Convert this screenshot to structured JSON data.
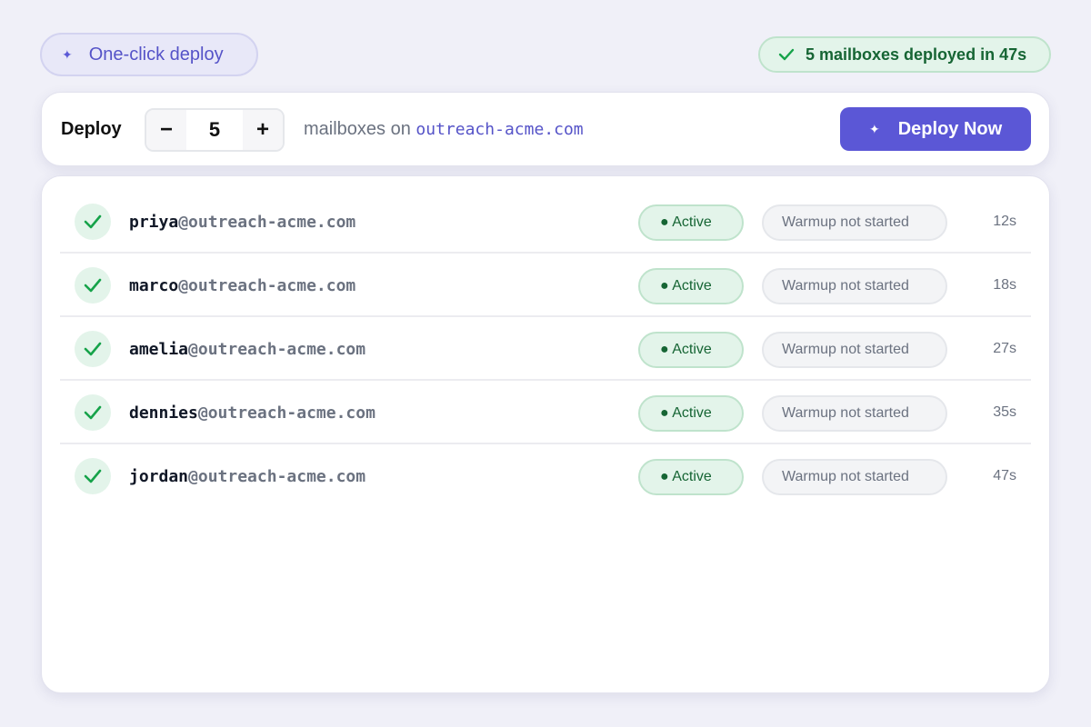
{
  "header": {
    "oneclick_label": "One-click deploy",
    "status_label": "5 mailboxes deployed in 47s"
  },
  "deploy": {
    "label": "Deploy",
    "decrement": "−",
    "count": "5",
    "increment": "+",
    "mailboxes_text": "mailboxes on ",
    "domain": "outreach-acme.com",
    "button_label": "Deploy Now"
  },
  "mailboxes": [
    {
      "user": "priya",
      "domain": "@outreach-acme.com",
      "status": "● Active",
      "warmup": "Warmup not started",
      "time": "12s"
    },
    {
      "user": "marco",
      "domain": "@outreach-acme.com",
      "status": "● Active",
      "warmup": "Warmup not started",
      "time": "18s"
    },
    {
      "user": "amelia",
      "domain": "@outreach-acme.com",
      "status": "● Active",
      "warmup": "Warmup not started",
      "time": "27s"
    },
    {
      "user": "dennies",
      "domain": "@outreach-acme.com",
      "status": "● Active",
      "warmup": "Warmup not started",
      "time": "35s"
    },
    {
      "user": "jordan",
      "domain": "@outreach-acme.com",
      "status": "● Active",
      "warmup": "Warmup not started",
      "time": "47s"
    }
  ],
  "colors": {
    "accent": "#5b57d6",
    "success": "#16a34a",
    "success_bg": "#e3f4ea",
    "background": "#f0f0f8"
  },
  "icons": {
    "sparkle": "sparkle-icon",
    "check": "check-icon"
  }
}
